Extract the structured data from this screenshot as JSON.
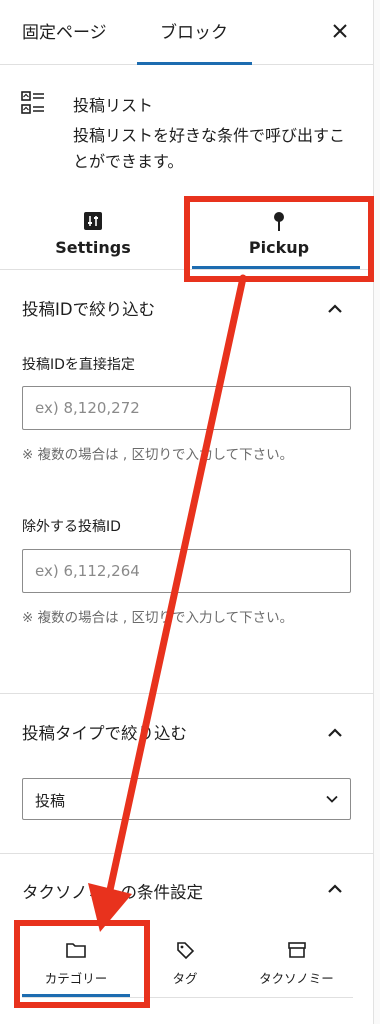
{
  "header": {
    "tabs": [
      {
        "label": "固定ページ"
      },
      {
        "label": "ブロック"
      }
    ]
  },
  "block": {
    "title": "投稿リスト",
    "description": "投稿リストを好きな条件で呼び出すことができます。"
  },
  "block_tabs": [
    {
      "label": "Settings",
      "icon": "sliders-icon"
    },
    {
      "label": "Pickup",
      "icon": "pin-icon"
    }
  ],
  "panels": {
    "id_filter": {
      "title": "投稿IDで絞り込む",
      "include": {
        "label": "投稿IDを直接指定",
        "placeholder": "ex) 8,120,272",
        "help": "※ 複数の場合は , 区切りで入力して下さい。"
      },
      "exclude": {
        "label": "除外する投稿ID",
        "placeholder": "ex) 6,112,264",
        "help": "※ 複数の場合は , 区切りで入力して下さい。"
      }
    },
    "type_filter": {
      "title": "投稿タイプで絞り込む",
      "selected": "投稿"
    },
    "taxonomy": {
      "title": "タクソノミーの条件設定",
      "tabs": [
        {
          "label": "カテゴリー",
          "icon": "folder-icon"
        },
        {
          "label": "タグ",
          "icon": "tag-icon"
        },
        {
          "label": "タクソノミー",
          "icon": "archive-icon"
        }
      ]
    }
  },
  "colors": {
    "annotation": "#e8321d",
    "accent": "#1d6cb0"
  }
}
